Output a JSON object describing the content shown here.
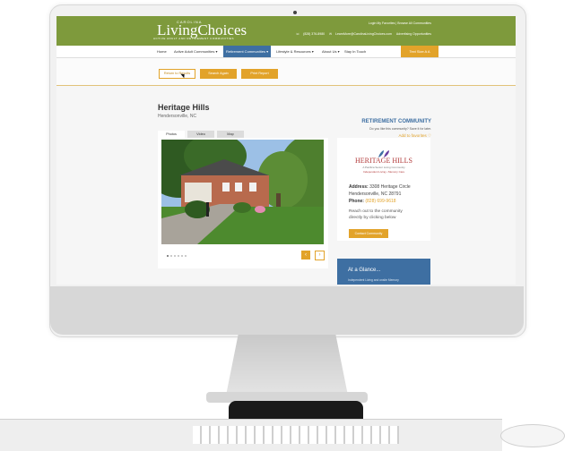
{
  "device": {
    "screen_bg": "#f6f6f6"
  },
  "header": {
    "logo_top": "CAROLINA",
    "logo_main": "LivingChoices",
    "logo_sub": "ACTIVE ADULT AND RETIREMENT COMMUNITIES",
    "links": "Login  My Favorites  |  Browse All Communities",
    "phone": "(828) 376-8980",
    "email": "LearnMore@CarolinaLivingChoices.com",
    "advertising": "Advertising Opportunities",
    "brand_color": "#7e9a3c"
  },
  "nav": {
    "items": [
      {
        "label": "Home"
      },
      {
        "label": "Active Adult Communities ▾"
      },
      {
        "label": "Retirement Communities ▾"
      },
      {
        "label": "Lifestyle & Resources ▾"
      },
      {
        "label": "About Us ▾"
      },
      {
        "label": "Stay In Touch"
      }
    ],
    "cta": "Text Size  A  A",
    "active_color": "#3e6fa2"
  },
  "actions": {
    "back": "Return to Results",
    "search_again": "Search Again",
    "print": "Print Report",
    "accent_color": "#e2a32a"
  },
  "listing": {
    "title": "Heritage Hills",
    "location": "Hendersonville, NC",
    "tabs": [
      "Photos",
      "Video",
      "Map"
    ],
    "prev_icon": "‹",
    "next_icon": "›"
  },
  "sidebar": {
    "label": "RETIREMENT COMMUNITY",
    "like_text": "Do you like this community? Save it for later.",
    "fav_text": "Add to favorites ♡"
  },
  "card": {
    "name": "HERITAGE HILLS",
    "tagline": "A Pacifica Senior Living Community",
    "services": "Independent Living • Memory Care",
    "address_label": "Address:",
    "address_1": "3308 Heritage Circle",
    "address_2": "Hendersonville, NC 28791",
    "phone_label": "Phone:",
    "phone": "(828) 699-9618",
    "reach_1": "Reach out to the community",
    "reach_2": "directly by clicking below",
    "button": "Contact Community"
  },
  "glance": {
    "title": "At a Glance...",
    "text": "Independent Living and onsite Memory"
  }
}
